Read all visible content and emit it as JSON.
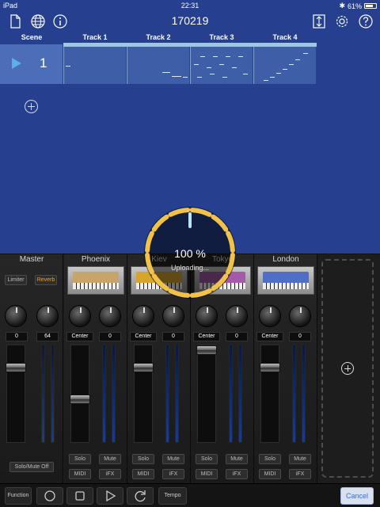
{
  "status_bar": {
    "carrier": "iPad",
    "time": "22:31",
    "battery": "61%",
    "battery_level": 0.61
  },
  "header": {
    "title": "170219",
    "icons": [
      "document-icon",
      "globe-icon",
      "info-icon",
      "resize-icon",
      "gear-icon",
      "help-icon"
    ]
  },
  "tracks": {
    "scene_label": "Scene",
    "names": [
      "Track 1",
      "Track 2",
      "Track 3",
      "Track 4"
    ]
  },
  "scene": {
    "number": "1"
  },
  "mixer": {
    "master": {
      "name": "Master",
      "limiter": "Limiter",
      "reverb": "Reverb",
      "val1": "0",
      "val2": "64",
      "solo_mute_off": "Solo/Mute Off"
    },
    "strips": [
      {
        "name": "Phoenix",
        "pan": "Center",
        "send": "0",
        "solo": "Solo",
        "mute": "Mute",
        "midi": "MIDI",
        "ifx": "iFX"
      },
      {
        "name": "Kiev",
        "pan": "Center",
        "send": "0",
        "solo": "Solo",
        "mute": "Mute",
        "midi": "MIDI",
        "ifx": "iFX"
      },
      {
        "name": "Tokyo",
        "pan": "Center",
        "send": "0",
        "solo": "Solo",
        "mute": "Mute",
        "midi": "MIDI",
        "ifx": "iFX"
      },
      {
        "name": "London",
        "pan": "Center",
        "send": "0",
        "solo": "Solo",
        "mute": "Mute",
        "midi": "MIDI",
        "ifx": "iFX"
      }
    ]
  },
  "bottom_bar": {
    "function": "Function",
    "tempo": "Tempo",
    "cancel": "Cancel"
  },
  "progress": {
    "percent_text": "100 %",
    "status": "Uploading...",
    "value": 1.0
  },
  "colors": {
    "background": "#26408f",
    "progress_ring": "#f0c24a",
    "accent": "#5ab0ea"
  }
}
